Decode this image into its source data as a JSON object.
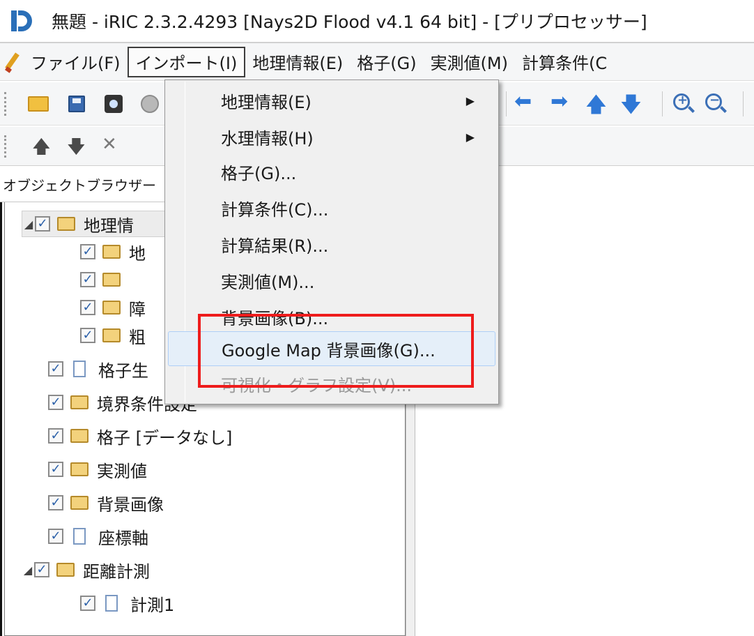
{
  "window": {
    "title": "無題 - iRIC 2.3.2.4293 [Nays2D Flood v4.1 64 bit] - [プリプロセッサー]"
  },
  "menubar": {
    "items": [
      "ファイル(F)",
      "インポート(I)",
      "地理情報(E)",
      "格子(G)",
      "実測値(M)",
      "計算条件(C"
    ],
    "active_index": 1
  },
  "object_browser": {
    "title": "オブジェクトブラウザー",
    "tree": [
      {
        "label": "地理情",
        "icon": "folder-icon",
        "expanded": true,
        "checked": true,
        "level": 0,
        "selected": true
      },
      {
        "label": "地",
        "icon": "folder-icon",
        "checked": true,
        "level": 1
      },
      {
        "label": "",
        "icon": "folder-icon",
        "checked": true,
        "level": 1
      },
      {
        "label": "障",
        "icon": "folder-icon",
        "checked": true,
        "level": 1
      },
      {
        "label": "粗",
        "icon": "folder-icon",
        "checked": true,
        "level": 1
      },
      {
        "label": "格子生",
        "icon": "file-icon",
        "checked": true,
        "level": 0
      },
      {
        "label": "境界条件設定",
        "icon": "folder-icon",
        "checked": true,
        "level": 0
      },
      {
        "label": "格子 [データなし]",
        "icon": "folder-icon",
        "checked": true,
        "level": 0
      },
      {
        "label": "実測値",
        "icon": "folder-icon",
        "checked": true,
        "level": 0
      },
      {
        "label": "背景画像",
        "icon": "folder-icon",
        "checked": true,
        "level": 0
      },
      {
        "label": "座標軸",
        "icon": "file-icon",
        "checked": true,
        "level": 0
      },
      {
        "label": "距離計測",
        "icon": "folder-icon",
        "expanded": true,
        "checked": true,
        "level": 0
      },
      {
        "label": "計測1",
        "icon": "file-icon",
        "checked": true,
        "level": 1
      }
    ]
  },
  "import_menu": {
    "items": [
      {
        "label": "地理情報(E)",
        "submenu": true
      },
      {
        "label": "水理情報(H)",
        "submenu": true
      },
      {
        "label": "格子(G)..."
      },
      {
        "label": "計算条件(C)..."
      },
      {
        "label": "計算結果(R)..."
      },
      {
        "label": "実測値(M)..."
      },
      {
        "label": "背景画像(B)..."
      },
      {
        "label": "Google Map 背景画像(G)...",
        "highlighted": true
      },
      {
        "label": "可視化・グラフ設定(V)...",
        "disabled": true
      }
    ],
    "submenu_arrow": "▶"
  },
  "icons": {
    "check": "✓",
    "expander": "◢",
    "up_arrow": "🡅",
    "down_arrow": "🡇",
    "delete": "✕",
    "left_arrow": "⬅",
    "right_arrow": "➡"
  },
  "colors": {
    "highlight_box": "#ee1c1c",
    "menu_hover": "#e5eff9",
    "accent_blue": "#2f78d6"
  }
}
